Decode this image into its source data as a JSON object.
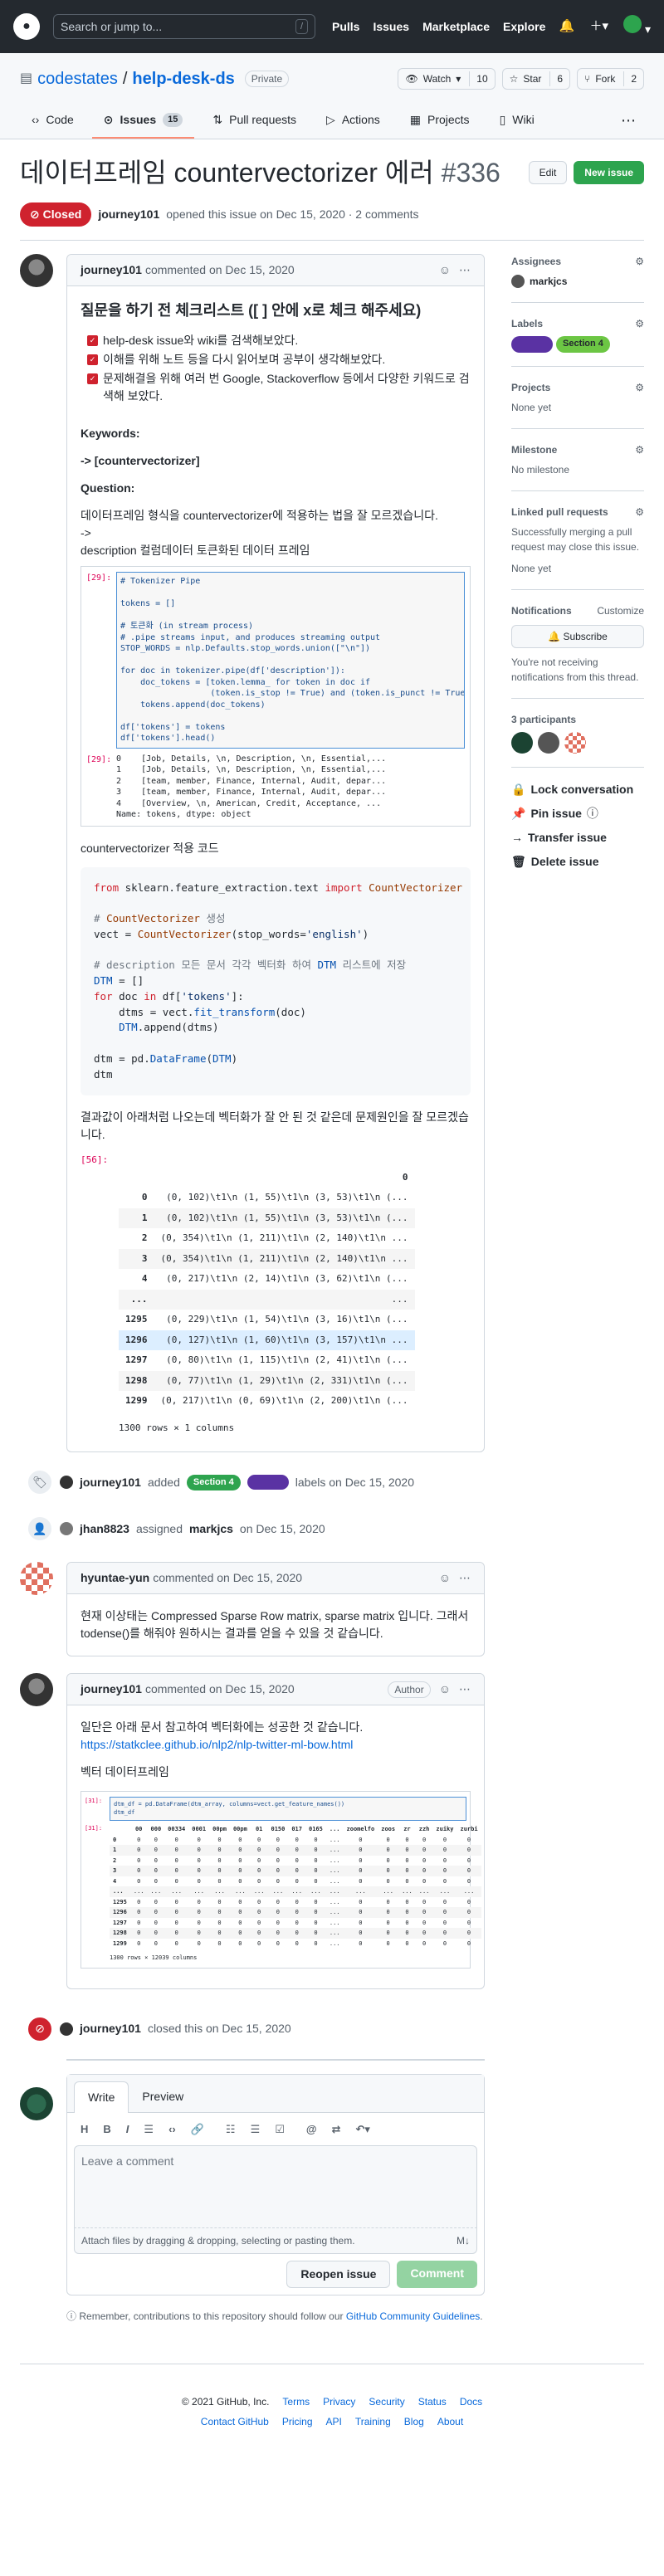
{
  "header": {
    "search_placeholder": "Search or jump to...",
    "slash": "/",
    "nav": [
      "Pulls",
      "Issues",
      "Marketplace",
      "Explore"
    ]
  },
  "repo": {
    "owner": "codestates",
    "sep": "/",
    "name": "help-desk-ds",
    "visibility": "Private",
    "watch": {
      "label": "Watch",
      "count": "10"
    },
    "star": {
      "label": "Star",
      "count": "6"
    },
    "fork": {
      "label": "Fork",
      "count": "2"
    },
    "tabs": [
      {
        "label": "Code"
      },
      {
        "label": "Issues",
        "count": "15"
      },
      {
        "label": "Pull requests"
      },
      {
        "label": "Actions"
      },
      {
        "label": "Projects"
      },
      {
        "label": "Wiki"
      }
    ]
  },
  "issue": {
    "title": "데이터프레임 countervectorizer 에러",
    "number": "#336",
    "edit": "Edit",
    "new_issue": "New issue",
    "state": "Closed",
    "author": "journey101",
    "meta": "opened this issue on Dec 15, 2020 · 2 comments"
  },
  "comment1": {
    "author": "journey101",
    "time": "commented on Dec 15, 2020",
    "heading": "질문을 하기 전 체크리스트 ([ ] 안에 x로 체크 해주세요)",
    "checks": [
      "help-desk issue와 wiki를 검색해보았다.",
      "이해를 위해 노트 등을 다시 읽어보며 공부이 생각해보았다.",
      "문제해결을 위해 여러 번 Google, Stackoverflow 등에서 다양한 키워드로 검색해 보았다."
    ],
    "kw_label": "Keywords:",
    "kw_value": "-> [countervectorizer]",
    "q_label": "Question:",
    "q_text1": "데이터프레임 형식을 countervectorizer에 적용하는 법을 잘 모르겠습니다.",
    "q_arrow": "->",
    "q_text2": "description 컬럼데이터 토큰화된 데이터 프레임",
    "nb1_prompt": "[29]:",
    "nb1_code": "# Tokenizer Pipe\n\ntokens = []\n\n# 토큰화 (in stream process)\n# .pipe streams input, and produces streaming output\nSTOP_WORDS = nlp.Defaults.stop_words.union([\"\\n\"])\n\nfor doc in tokenizer.pipe(df['description']):\n    doc_tokens = [token.lemma_ for token in doc if\n                  (token.is_stop != True) and (token.is_punct != True)\n    tokens.append(doc_tokens)\n\ndf['tokens'] = tokens\ndf['tokens'].head()",
    "nb1_out_prompt": "[29]:",
    "nb1_out": "0    [Job, Details, \\n, Description, \\n, Essential,...\n1    [Job, Details, \\n, Description, \\n, Essential,...\n2    [team, member, Finance, Internal, Audit, depar...\n3    [team, member, Finance, Internal, Audit, depar...\n4    [Overview, \\n, American, Credit, Acceptance, ...\nName: tokens, dtype: object",
    "cv_label": "countervectorizer 적용 코드",
    "result_label": "결과값이 아래처럼 나오는데 벡터화가 잘 안 된 것 같은데 문제원인을 잘 모르겠습니다.",
    "df_prompt": "[56]:",
    "df_col": "0",
    "df_rows": [
      {
        "i": "0",
        "v": "(0, 102)\\t1\\n (1, 55)\\t1\\n (3, 53)\\t1\\n (..."
      },
      {
        "i": "1",
        "v": "(0, 102)\\t1\\n (1, 55)\\t1\\n (3, 53)\\t1\\n (..."
      },
      {
        "i": "2",
        "v": "(0, 354)\\t1\\n (1, 211)\\t1\\n (2, 140)\\t1\\n ..."
      },
      {
        "i": "3",
        "v": "(0, 354)\\t1\\n (1, 211)\\t1\\n (2, 140)\\t1\\n ..."
      },
      {
        "i": "4",
        "v": "(0, 217)\\t1\\n (2, 14)\\t1\\n (3, 62)\\t1\\n (..."
      },
      {
        "i": "...",
        "v": "..."
      },
      {
        "i": "1295",
        "v": "(0, 229)\\t1\\n (1, 54)\\t1\\n (3, 16)\\t1\\n (..."
      },
      {
        "i": "1296",
        "v": "(0, 127)\\t1\\n (1, 60)\\t1\\n (3, 157)\\t1\\n ..."
      },
      {
        "i": "1297",
        "v": "(0, 80)\\t1\\n (1, 115)\\t1\\n (2, 41)\\t1\\n (..."
      },
      {
        "i": "1298",
        "v": "(0, 77)\\t1\\n (1, 29)\\t1\\n (2, 331)\\t1\\n (..."
      },
      {
        "i": "1299",
        "v": "(0, 217)\\t1\\n (0, 69)\\t1\\n (2, 200)\\t1\\n (..."
      }
    ],
    "df_shape": "1300 rows × 1 columns"
  },
  "event_labels": {
    "actor": "journey101",
    "added": "added",
    "label1": "Section 4",
    "label1_color": "#2ea44f",
    "label2_color": "#5a32a3",
    "text": "labels on Dec 15, 2020"
  },
  "event_assign": {
    "actor": "jhan8823",
    "text1": "assigned",
    "assignee": "markjcs",
    "text2": "on Dec 15, 2020"
  },
  "comment2": {
    "author": "hyuntae-yun",
    "time": "commented on Dec 15, 2020",
    "body": "현재 이상태는 Compressed Sparse Row matrix, sparse matrix 입니다. 그래서 todense()를 해줘야 원하시는 결과를 얻을 수 있을 것 같습니다."
  },
  "comment3": {
    "author": "journey101",
    "time": "commented on Dec 15, 2020",
    "badge": "Author",
    "body": "일단은 아래 문서 참고하여 벡터화에는 성공한 것 같습니다.",
    "link": "https://statkclee.github.io/nlp2/nlp-twitter-ml-bow.html",
    "sub": "벡터 데이터프레임",
    "nb_prompt": "[31]:",
    "nb_code": "dtm_df = pd.DataFrame(dtm_array, columns=vect.get_feature_names())\ndtm_df",
    "nb_out_prompt": "[31]:",
    "cols": [
      "00",
      "000",
      "00334",
      "0001",
      "00pm",
      "00pm",
      "01",
      "0150",
      "017",
      "0165",
      "...",
      "zoomelfo",
      "zoos",
      "zr",
      "zzh",
      "zuiky",
      "zurbi"
    ],
    "rows": [
      "0",
      "1",
      "2",
      "3",
      "4",
      "...",
      "1295",
      "1296",
      "1297",
      "1298",
      "1299"
    ],
    "shape": "1300 rows × 12039 columns"
  },
  "event_closed": {
    "actor": "journey101",
    "text": "closed this on Dec 15, 2020"
  },
  "composer": {
    "tab_write": "Write",
    "tab_preview": "Preview",
    "placeholder": "Leave a comment",
    "attach": "Attach files by dragging & dropping, selecting or pasting them.",
    "md": "M↓",
    "reopen": "Reopen issue",
    "comment": "Comment"
  },
  "note": {
    "text": "Remember, contributions to this repository should follow our",
    "link": "GitHub Community Guidelines",
    "end": "."
  },
  "sidebar": {
    "assignees": "Assignees",
    "assignee": "markjcs",
    "labels": "Labels",
    "label_purple": "#5a32a3",
    "label_green": "#6cc644",
    "label_green_text": "Section 4",
    "projects": "Projects",
    "projects_val": "None yet",
    "milestone": "Milestone",
    "milestone_val": "No milestone",
    "linked": "Linked pull requests",
    "linked_desc": "Successfully merging a pull request may close this issue.",
    "linked_val": "None yet",
    "notifications": "Notifications",
    "customize": "Customize",
    "subscribe": "Subscribe",
    "notif_desc": "You're not receiving notifications from this thread.",
    "participants": "3 participants",
    "lock": "Lock conversation",
    "pin": "Pin issue",
    "transfer": "Transfer issue",
    "delete": "Delete issue"
  },
  "footer": {
    "copyright": "© 2021 GitHub, Inc.",
    "row1": [
      "Terms",
      "Privacy",
      "Security",
      "Status",
      "Docs"
    ],
    "row2": [
      "Contact GitHub",
      "Pricing",
      "API",
      "Training",
      "Blog",
      "About"
    ]
  }
}
